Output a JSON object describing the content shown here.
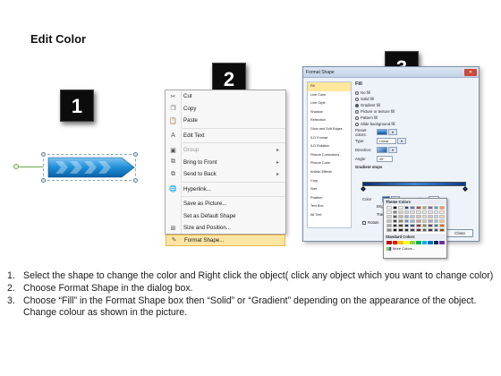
{
  "title": "Edit Color",
  "badges": [
    "1",
    "2",
    "3"
  ],
  "context_menu": {
    "items": [
      {
        "label": "Cut",
        "icon": "scissors-icon",
        "glyph": "✂",
        "disabled": false,
        "submenu": false
      },
      {
        "label": "Copy",
        "icon": "copy-icon",
        "glyph": "❐",
        "disabled": false,
        "submenu": false
      },
      {
        "label": "Paste",
        "icon": "paste-icon",
        "glyph": "📋",
        "disabled": false,
        "submenu": false
      },
      {
        "label": "Edit Text",
        "icon": "edit-text-icon",
        "glyph": "A",
        "disabled": false,
        "submenu": false
      },
      {
        "label": "Group",
        "icon": "group-icon",
        "glyph": "▣",
        "disabled": true,
        "submenu": true
      },
      {
        "label": "Bring to Front",
        "icon": "bring-front-icon",
        "glyph": "⧉",
        "disabled": false,
        "submenu": true
      },
      {
        "label": "Send to Back",
        "icon": "send-back-icon",
        "glyph": "⧉",
        "disabled": false,
        "submenu": true
      },
      {
        "label": "Hyperlink...",
        "icon": "hyperlink-icon",
        "glyph": "🌐",
        "disabled": false,
        "submenu": false
      },
      {
        "label": "Save as Picture...",
        "icon": "",
        "glyph": "",
        "disabled": false,
        "submenu": false
      },
      {
        "label": "Set as Default Shape",
        "icon": "",
        "glyph": "",
        "disabled": false,
        "submenu": false
      },
      {
        "label": "Size and Position...",
        "icon": "size-position-icon",
        "glyph": "⊞",
        "disabled": false,
        "submenu": false
      },
      {
        "label": "Format Shape...",
        "icon": "format-shape-icon",
        "glyph": "✎",
        "disabled": false,
        "submenu": false,
        "highlight": true
      }
    ]
  },
  "dialog": {
    "title": "Format Shape",
    "nav": [
      "Fill",
      "Line Color",
      "Line Style",
      "Shadow",
      "Reflection",
      "Glow and Soft Edges",
      "3-D Format",
      "3-D Rotation",
      "Picture Corrections",
      "Picture Color",
      "Artistic Effects",
      "Crop",
      "Size",
      "Position",
      "Text Box",
      "Alt Text"
    ],
    "pane_title": "Fill",
    "fill_options": [
      {
        "label": "No fill",
        "selected": false
      },
      {
        "label": "Solid fill",
        "selected": false
      },
      {
        "label": "Gradient fill",
        "selected": true
      },
      {
        "label": "Picture or texture fill",
        "selected": false
      },
      {
        "label": "Pattern fill",
        "selected": false
      },
      {
        "label": "Slide background fill",
        "selected": false
      }
    ],
    "preset_colors_label": "Preset colors:",
    "type_label": "Type:",
    "type_value": "Linear",
    "direction_label": "Direction:",
    "angle_label": "Angle:",
    "angle_value": "45°",
    "gradient_stops_label": "Gradient stops",
    "color_label": "Color",
    "position_label": "Position:",
    "position_value": "0%",
    "brightness_label": "Brightness:",
    "transparency_label": "Transpare",
    "rotate_label": "Rotate",
    "close_label": "Close"
  },
  "palette": {
    "theme_label": "Theme Colors",
    "standard_label": "Standard Colors",
    "more_label": "More Colors...",
    "theme_colors": [
      "#ffffff",
      "#000000",
      "#eeece1",
      "#1f497d",
      "#4f81bd",
      "#c0504d",
      "#9bbb59",
      "#8064a2",
      "#4bacc6",
      "#f79646",
      "#f2f2f2",
      "#7f7f7f",
      "#ddd9c3",
      "#c6d9f0",
      "#dbe5f1",
      "#f2dcdb",
      "#ebf1dd",
      "#e5e0ec",
      "#dbeef3",
      "#fdeada",
      "#d8d8d8",
      "#595959",
      "#c4bd97",
      "#8db3e2",
      "#b8cce4",
      "#e5b9b7",
      "#d7e3bc",
      "#ccc1d9",
      "#b7dde8",
      "#fbd5b5",
      "#bfbfbf",
      "#3f3f3f",
      "#938953",
      "#548dd4",
      "#95b3d7",
      "#d99694",
      "#c3d69b",
      "#b2a2c7",
      "#92cddc",
      "#fac08f",
      "#a5a5a5",
      "#262626",
      "#494429",
      "#17365d",
      "#366092",
      "#953734",
      "#76923c",
      "#5f497a",
      "#31859b",
      "#e36c09",
      "#7f7f7f",
      "#0c0c0c",
      "#1d1b10",
      "#0f243e",
      "#244061",
      "#632423",
      "#4f6128",
      "#3f3151",
      "#205867",
      "#974806"
    ],
    "standard_colors": [
      "#c00000",
      "#ff0000",
      "#ffc000",
      "#ffff00",
      "#92d050",
      "#00b050",
      "#00b0f0",
      "#0070c0",
      "#002060",
      "#7030a0"
    ]
  },
  "instructions": [
    {
      "num": "1.",
      "text": "Select the shape to change the color and Right click the object( click any object which you want to change color)"
    },
    {
      "num": "2.",
      "text": "Choose Format Shape in the dialog box."
    },
    {
      "num": "3.",
      "text": "Choose “Fill” in the Format Shape box then “Solid” or “Gradient” depending on the appearance of the object. Change colour as shown in the picture."
    }
  ]
}
